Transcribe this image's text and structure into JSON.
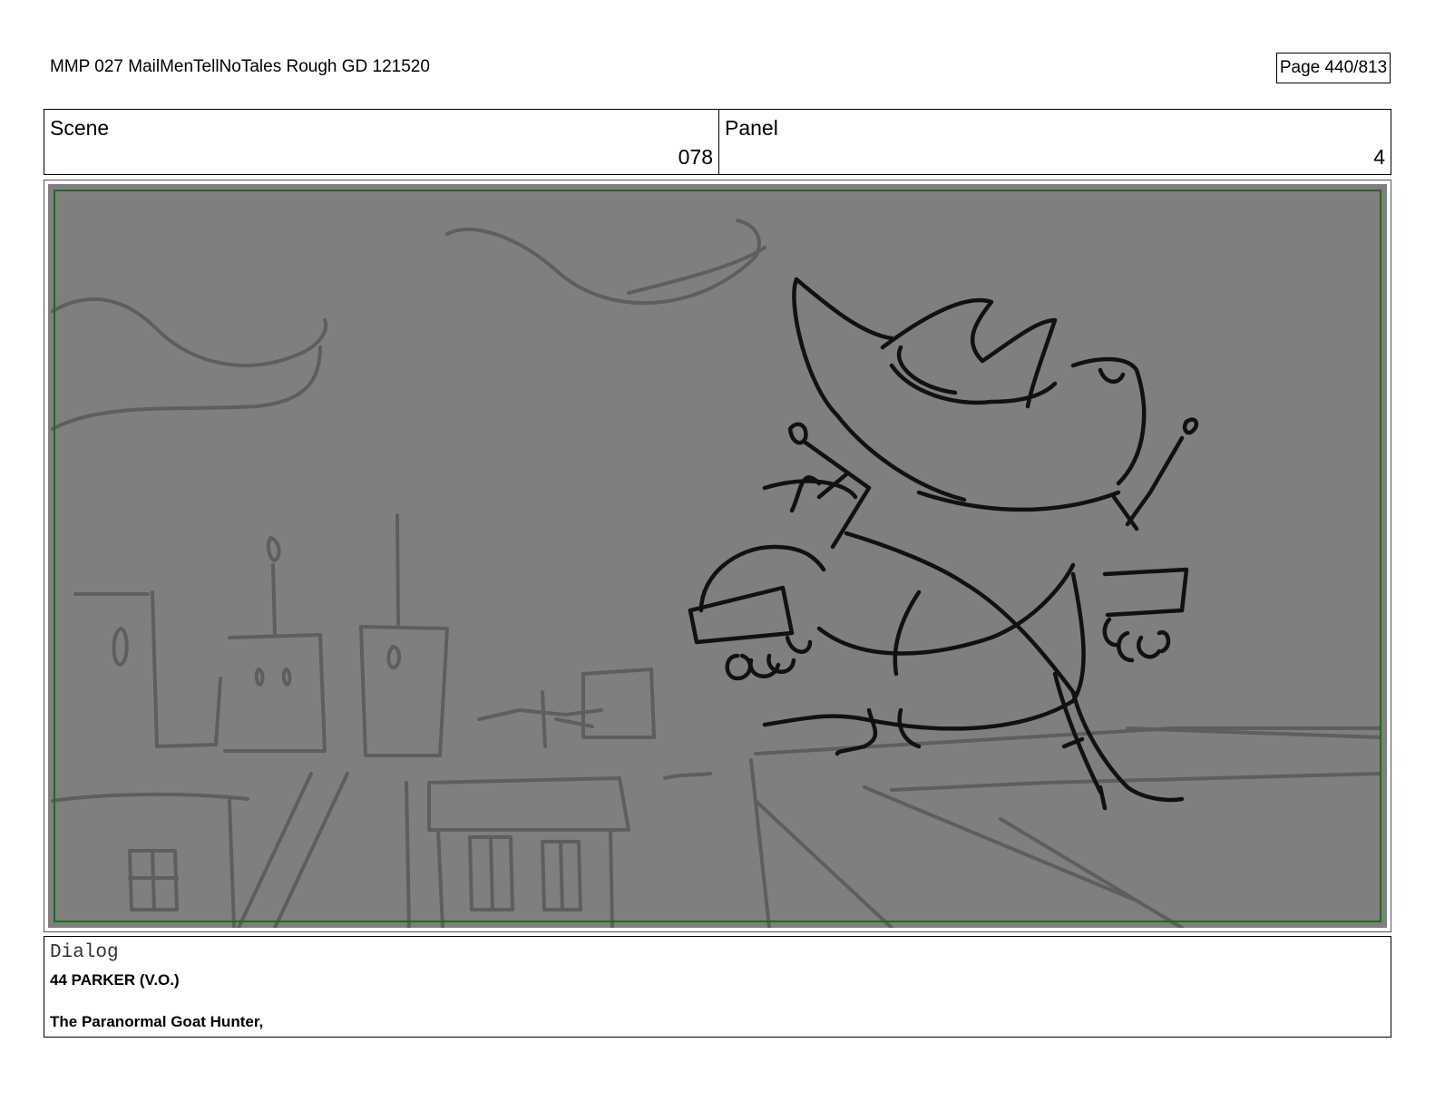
{
  "document": {
    "title": "MMP 027 MailMenTellNoTales Rough GD 121520",
    "page": "Page 440/813"
  },
  "header": {
    "scene_label": "Scene",
    "scene_value": "078",
    "panel_label": "Panel",
    "panel_value": "4"
  },
  "panel_image": {
    "kind": "storyboard-sketch",
    "background_color": "#7f7f7f",
    "safe_area_color": "#1f6b1f"
  },
  "dialog": {
    "label": "Dialog",
    "speaker": "44 PARKER (V.O.)",
    "line": "The Paranormal Goat Hunter,"
  }
}
